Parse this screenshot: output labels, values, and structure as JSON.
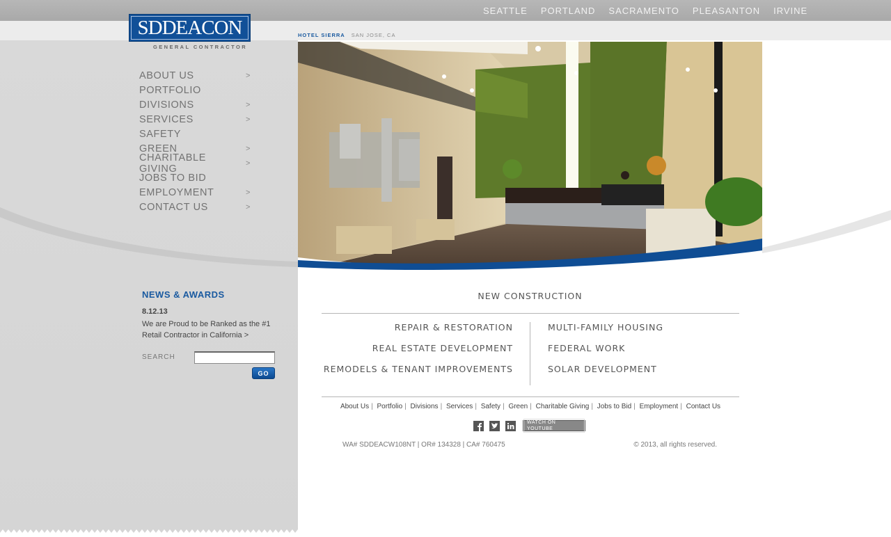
{
  "header": {
    "cities": [
      "SEATTLE",
      "PORTLAND",
      "SACRAMENTO",
      "PLEASANTON",
      "IRVINE"
    ]
  },
  "logo": {
    "text": "SDDEACON",
    "tagline": "GENERAL CONTRACTOR"
  },
  "nav": [
    {
      "label": "ABOUT US",
      "arrow": ">"
    },
    {
      "label": "PORTFOLIO",
      "arrow": ""
    },
    {
      "label": "DIVISIONS",
      "arrow": ">"
    },
    {
      "label": "SERVICES",
      "arrow": ">"
    },
    {
      "label": "SAFETY",
      "arrow": ""
    },
    {
      "label": "GREEN",
      "arrow": ">"
    },
    {
      "label": "CHARITABLE GIVING",
      "arrow": ">"
    },
    {
      "label": "JOBS TO BID",
      "arrow": ""
    },
    {
      "label": "EMPLOYMENT",
      "arrow": ">"
    },
    {
      "label": "CONTACT US",
      "arrow": ">"
    }
  ],
  "hero": {
    "caption_name": "HOTEL SIERRA",
    "caption_location": "SAN JOSE, CA"
  },
  "news": {
    "title": "NEWS & AWARDS",
    "date": "8.12.13",
    "text": "We are Proud to be Ranked as the #1 Retail Contractor in California >"
  },
  "search": {
    "label": "SEARCH",
    "value": "",
    "button": "GO"
  },
  "divisions": {
    "headline": "NEW CONSTRUCTION",
    "left": [
      "REPAIR & RESTORATION",
      "REAL ESTATE DEVELOPMENT",
      "REMODELS & TENANT IMPROVEMENTS"
    ],
    "right": [
      "MULTI-FAMILY HOUSING",
      "FEDERAL WORK",
      "SOLAR DEVELOPMENT"
    ]
  },
  "footer": {
    "links": [
      "About Us",
      "Portfolio",
      "Divisions",
      "Services",
      "Safety",
      "Green",
      "Charitable Giving",
      "Jobs to Bid",
      "Employment",
      "Contact Us"
    ],
    "separator": "|",
    "youtube": "WATCH ON YOUTUBE",
    "social_icons": [
      "facebook-icon",
      "twitter-icon",
      "linkedin-icon"
    ],
    "license": "WA# SDDEACW108NT | OR# 134328 | CA# 760475",
    "copyright": "© 2013, all rights reserved."
  },
  "colors": {
    "brand_blue": "#115098",
    "link_blue": "#1a5aa0",
    "nav_gray": "#727272"
  }
}
